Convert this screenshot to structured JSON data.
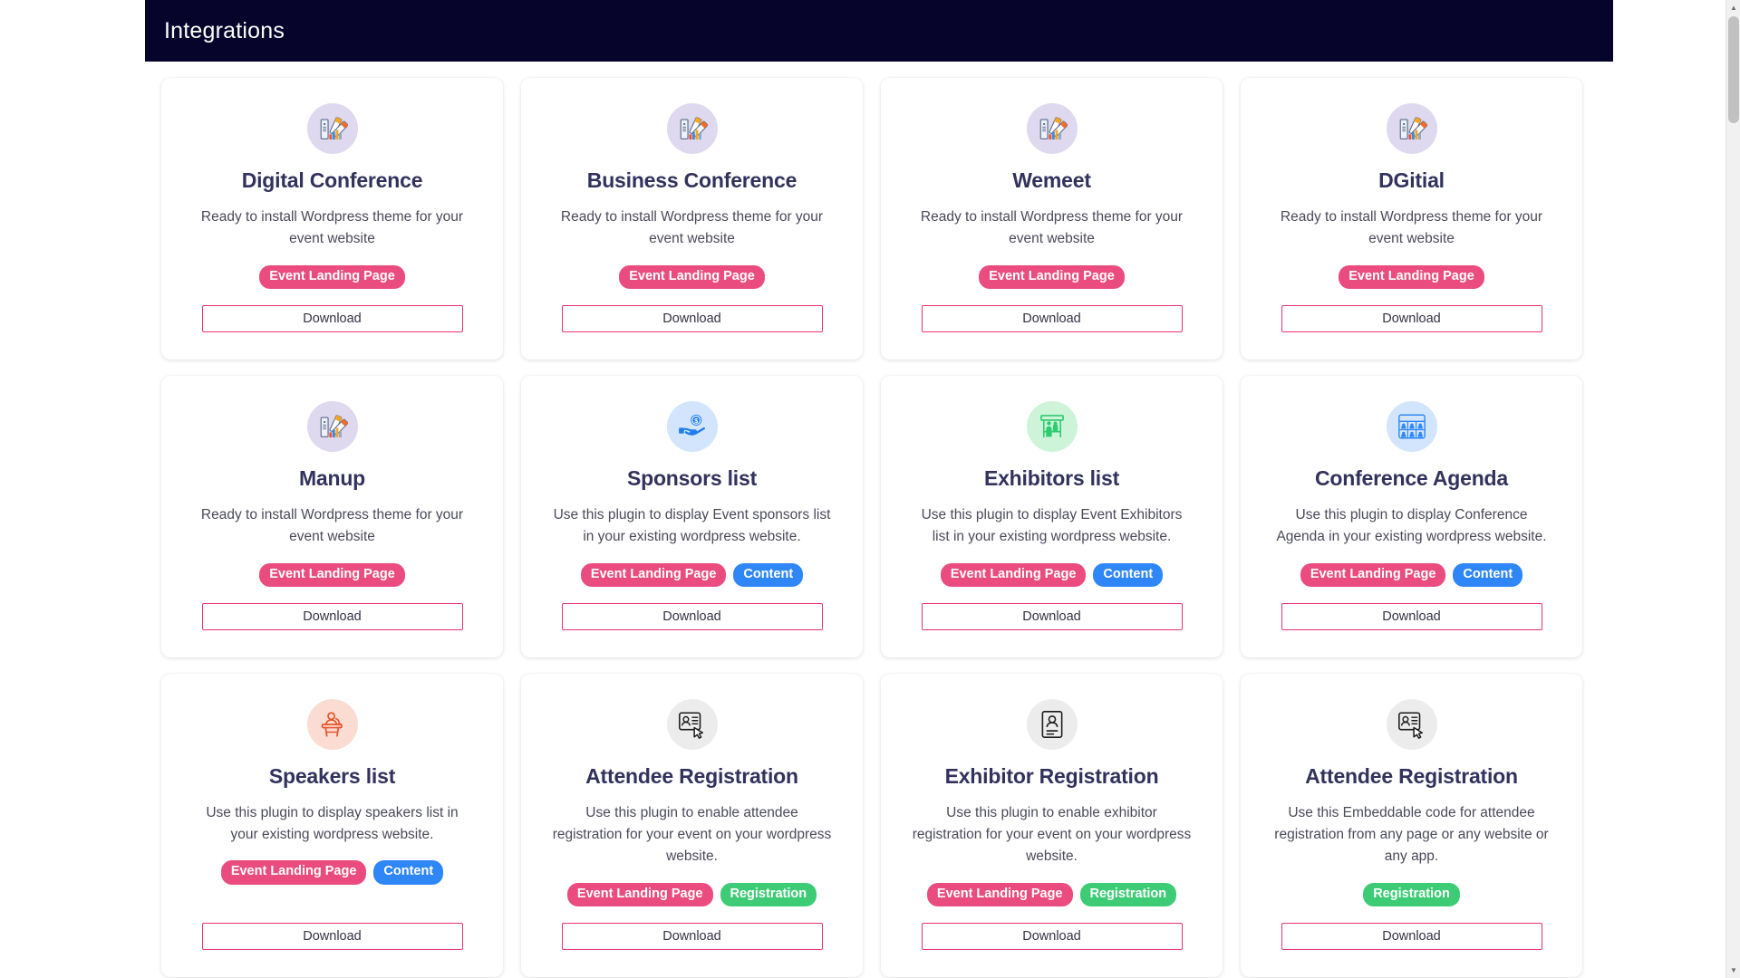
{
  "header": {
    "title": "Integrations"
  },
  "scrollbar": {
    "up_arrow": "▲",
    "down_arrow": "▼"
  },
  "common": {
    "download_label": "Download"
  },
  "badge_colors": {
    "event_landing_page": "#ea4c7f",
    "content": "#2f86f6",
    "registration": "#3dcc75"
  },
  "cards": [
    {
      "title": "Digital Conference",
      "description": "Ready to install Wordpress theme for your event website",
      "icon": "themes-palette-icon",
      "icon_bg": "#ded9ee",
      "badges": [
        {
          "label": "Event Landing Page",
          "type": "landing"
        }
      ],
      "download_label": "Download"
    },
    {
      "title": "Business Conference",
      "description": "Ready to install Wordpress theme for your event website",
      "icon": "themes-palette-icon",
      "icon_bg": "#ded9ee",
      "badges": [
        {
          "label": "Event Landing Page",
          "type": "landing"
        }
      ],
      "download_label": "Download"
    },
    {
      "title": "Wemeet",
      "description": "Ready to install Wordpress theme for your event website",
      "icon": "themes-palette-icon",
      "icon_bg": "#ded9ee",
      "badges": [
        {
          "label": "Event Landing Page",
          "type": "landing"
        }
      ],
      "download_label": "Download"
    },
    {
      "title": "DGitial",
      "description": "Ready to install Wordpress theme for your event website",
      "icon": "themes-palette-icon",
      "icon_bg": "#ded9ee",
      "badges": [
        {
          "label": "Event Landing Page",
          "type": "landing"
        }
      ],
      "download_label": "Download"
    },
    {
      "title": "Manup",
      "description": "Ready to install Wordpress theme for your event website",
      "icon": "themes-palette-icon",
      "icon_bg": "#ded9ee",
      "badges": [
        {
          "label": "Event Landing Page",
          "type": "landing"
        }
      ],
      "download_label": "Download"
    },
    {
      "title": "Sponsors list",
      "description": "Use this plugin to display Event sponsors list in your existing wordpress website.",
      "icon": "hand-holding-coin-icon",
      "icon_bg": "#d3e5fd",
      "badges": [
        {
          "label": "Event Landing Page",
          "type": "landing"
        },
        {
          "label": "Content",
          "type": "content"
        }
      ],
      "download_label": "Download"
    },
    {
      "title": "Exhibitors list",
      "description": "Use this plugin to display Event Exhibitors list in your existing wordpress website.",
      "icon": "exhibition-booth-icon",
      "icon_bg": "#cdf3d8",
      "badges": [
        {
          "label": "Event Landing Page",
          "type": "landing"
        },
        {
          "label": "Content",
          "type": "content"
        }
      ],
      "download_label": "Download"
    },
    {
      "title": "Conference Agenda",
      "description": "Use this plugin to display Conference Agenda in your existing wordpress website.",
      "icon": "agenda-people-grid-icon",
      "icon_bg": "#d3e5fd",
      "badges": [
        {
          "label": "Event Landing Page",
          "type": "landing"
        },
        {
          "label": "Content",
          "type": "content"
        }
      ],
      "download_label": "Download"
    },
    {
      "title": "Speakers list",
      "description": "Use this plugin to display speakers list in your existing wordpress website.",
      "icon": "speaker-podium-icon",
      "icon_bg": "#fbdcd2",
      "badges": [
        {
          "label": "Event Landing Page",
          "type": "landing"
        },
        {
          "label": "Content",
          "type": "content"
        }
      ],
      "download_label": "Download"
    },
    {
      "title": "Attendee Registration",
      "description": "Use this plugin to enable attendee registration for your event on your wordpress website.",
      "icon": "registration-badge-click-icon",
      "icon_bg": "#ececec",
      "badges": [
        {
          "label": "Event Landing Page",
          "type": "landing"
        },
        {
          "label": "Registration",
          "type": "registration"
        }
      ],
      "download_label": "Download"
    },
    {
      "title": "Exhibitor Registration",
      "description": "Use this plugin to enable exhibitor registration for your event on your wordpress website.",
      "icon": "registration-form-icon",
      "icon_bg": "#ececec",
      "badges": [
        {
          "label": "Event Landing Page",
          "type": "landing"
        },
        {
          "label": "Registration",
          "type": "registration"
        }
      ],
      "download_label": "Download"
    },
    {
      "title": "Attendee Registration",
      "description": "Use this Embeddable code for attendee registration from any page or any website or any app.",
      "icon": "registration-badge-click-icon",
      "icon_bg": "#ececec",
      "badges": [
        {
          "label": "Registration",
          "type": "registration"
        }
      ],
      "download_label": "Download"
    }
  ]
}
